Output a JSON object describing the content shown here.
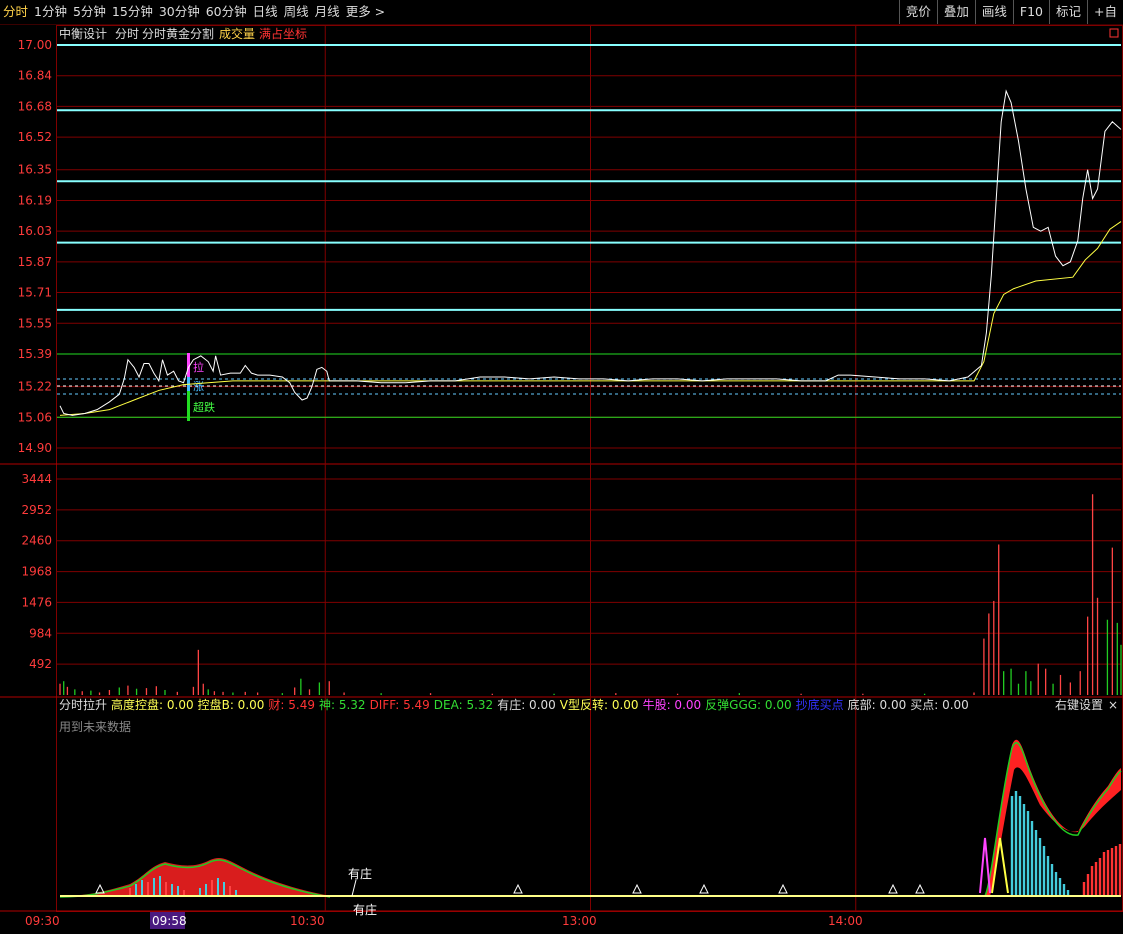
{
  "toolbar": {
    "periods": [
      "分时",
      "1分钟",
      "5分钟",
      "15分钟",
      "30分钟",
      "60分钟",
      "日线",
      "周线",
      "月线",
      "更多 >"
    ],
    "right": [
      "竞价",
      "叠加",
      "画线",
      "F10",
      "标记",
      "+自"
    ]
  },
  "price_panel": {
    "name": "中衡设计",
    "label_fenshi": "分时",
    "label_golden": "分时黄金分割",
    "label_volume": "成交量",
    "label_fullcoord": "满占坐标"
  },
  "indicator_panel": {
    "legend": [
      {
        "text": "分时拉升",
        "color": "#dddddd"
      },
      {
        "text": "高度控盘: 0.00",
        "color": "#ffff55"
      },
      {
        "text": "控盘B: 0.00",
        "color": "#ffff55"
      },
      {
        "text": "财: 5.49",
        "color": "#ff3333"
      },
      {
        "text": "神: 5.32",
        "color": "#33dd33"
      },
      {
        "text": "DIFF: 5.49",
        "color": "#ff3333"
      },
      {
        "text": "DEA: 5.32",
        "color": "#33dd33"
      },
      {
        "text": "有庄: 0.00",
        "color": "#dddddd"
      },
      {
        "text": "V型反转: 0.00",
        "color": "#ffff55"
      },
      {
        "text": "牛股: 0.00",
        "color": "#ff44ff"
      },
      {
        "text": "反弹GGG: 0.00",
        "color": "#33dd33"
      },
      {
        "text": "抄底买点",
        "color": "#3333ff"
      },
      {
        "text": "底部: 0.00",
        "color": "#dddddd"
      },
      {
        "text": "买点: 0.00",
        "color": "#dddddd"
      }
    ],
    "settings": "右键设置",
    "close": "×",
    "warning": "用到未来数据",
    "annotation": "有庄"
  },
  "signals": {
    "up": "拉",
    "mid": "涨",
    "down": "超跌"
  },
  "time_axis": {
    "labels": [
      "09:30",
      "10:30",
      "13:00",
      "14:00"
    ],
    "cursor": "09:58"
  },
  "colors": {
    "price_line": "#ffffff",
    "avg_line": "#ffff44",
    "golden": "#88ffff",
    "grid": "#800000",
    "axis_text": "#ff3b3b",
    "vol_up": "#ff4444",
    "vol_down": "#22cc22"
  },
  "chart_data": [
    {
      "type": "line",
      "y_ticks": [
        "17.00",
        "16.84",
        "16.68",
        "16.52",
        "16.35",
        "16.19",
        "16.03",
        "15.87",
        "15.71",
        "15.55",
        "15.39",
        "15.22",
        "15.06",
        "14.90"
      ],
      "ylim": [
        14.9,
        17.0
      ],
      "golden_levels": [
        17.0,
        16.66,
        16.29,
        15.97,
        15.62
      ],
      "range_levels": [
        15.39,
        15.06
      ],
      "series": [
        {
          "values": [
            [
              0,
              15.12
            ],
            [
              3,
              15.08
            ],
            [
              10,
              15.07
            ],
            [
              20,
              15.08
            ],
            [
              30,
              15.1
            ],
            [
              40,
              15.14
            ],
            [
              48,
              15.18
            ],
            [
              52,
              15.26
            ],
            [
              55,
              15.36
            ],
            [
              60,
              15.32
            ],
            [
              64,
              15.27
            ],
            [
              68,
              15.34
            ],
            [
              72,
              15.34
            ],
            [
              76,
              15.29
            ],
            [
              80,
              15.25
            ],
            [
              83,
              15.36
            ],
            [
              87,
              15.28
            ],
            [
              92,
              15.3
            ],
            [
              96,
              15.25
            ],
            [
              100,
              15.24
            ],
            [
              104,
              15.32
            ],
            [
              108,
              15.36
            ],
            [
              114,
              15.38
            ],
            [
              120,
              15.35
            ],
            [
              124,
              15.3
            ],
            [
              126,
              15.38
            ],
            [
              130,
              15.28
            ],
            [
              138,
              15.29
            ],
            [
              146,
              15.29
            ],
            [
              150,
              15.33
            ],
            [
              155,
              15.29
            ],
            [
              160,
              15.28
            ],
            [
              170,
              15.28
            ],
            [
              180,
              15.27
            ],
            [
              186,
              15.24
            ],
            [
              190,
              15.19
            ],
            [
              196,
              15.15
            ],
            [
              200,
              15.16
            ],
            [
              204,
              15.22
            ],
            [
              208,
              15.31
            ],
            [
              212,
              15.32
            ],
            [
              216,
              15.3
            ],
            [
              218,
              15.25
            ],
            [
              226,
              15.25
            ],
            [
              240,
              15.25
            ],
            [
              260,
              15.24
            ],
            [
              280,
              15.24
            ],
            [
              300,
              15.25
            ],
            [
              320,
              15.25
            ],
            [
              340,
              15.27
            ],
            [
              360,
              15.27
            ],
            [
              380,
              15.26
            ],
            [
              400,
              15.27
            ],
            [
              420,
              15.26
            ],
            [
              440,
              15.26
            ],
            [
              460,
              15.25
            ],
            [
              480,
              15.26
            ],
            [
              500,
              15.26
            ],
            [
              520,
              15.25
            ],
            [
              540,
              15.26
            ],
            [
              560,
              15.26
            ],
            [
              580,
              15.26
            ],
            [
              600,
              15.25
            ],
            [
              620,
              15.25
            ],
            [
              630,
              15.28
            ],
            [
              640,
              15.28
            ],
            [
              660,
              15.27
            ],
            [
              680,
              15.26
            ],
            [
              700,
              15.26
            ],
            [
              720,
              15.25
            ],
            [
              735,
              15.27
            ],
            [
              746,
              15.33
            ],
            [
              750,
              15.5
            ],
            [
              754,
              15.8
            ],
            [
              758,
              16.2
            ],
            [
              762,
              16.6
            ],
            [
              766,
              16.76
            ],
            [
              770,
              16.7
            ],
            [
              776,
              16.5
            ],
            [
              782,
              16.25
            ],
            [
              788,
              16.05
            ],
            [
              794,
              16.03
            ],
            [
              800,
              16.05
            ],
            [
              806,
              15.9
            ],
            [
              812,
              15.85
            ],
            [
              818,
              15.87
            ],
            [
              824,
              15.98
            ],
            [
              828,
              16.2
            ],
            [
              832,
              16.35
            ],
            [
              836,
              16.2
            ],
            [
              840,
              16.25
            ],
            [
              846,
              16.55
            ],
            [
              852,
              16.6
            ],
            [
              859,
              16.56
            ]
          ]
        },
        {
          "values": [
            [
              0,
              15.07
            ],
            [
              20,
              15.08
            ],
            [
              40,
              15.1
            ],
            [
              60,
              15.15
            ],
            [
              80,
              15.2
            ],
            [
              100,
              15.23
            ],
            [
              120,
              15.24
            ],
            [
              140,
              15.25
            ],
            [
              160,
              15.25
            ],
            [
              200,
              15.25
            ],
            [
              240,
              15.25
            ],
            [
              300,
              15.25
            ],
            [
              400,
              15.25
            ],
            [
              500,
              15.25
            ],
            [
              600,
              15.25
            ],
            [
              700,
              15.25
            ],
            [
              740,
              15.25
            ],
            [
              748,
              15.35
            ],
            [
              756,
              15.6
            ],
            [
              764,
              15.7
            ],
            [
              772,
              15.73
            ],
            [
              790,
              15.77
            ],
            [
              820,
              15.79
            ],
            [
              830,
              15.88
            ],
            [
              840,
              15.94
            ],
            [
              850,
              16.04
            ],
            [
              859,
              16.08
            ]
          ]
        }
      ]
    },
    {
      "type": "bar",
      "y_ticks": [
        "3444",
        "2952",
        "2460",
        "1968",
        "1476",
        "984",
        "492"
      ],
      "ylim": [
        0,
        3444
      ],
      "values": [
        [
          0,
          180,
          "u"
        ],
        [
          3,
          220,
          "d"
        ],
        [
          6,
          130,
          "u"
        ],
        [
          12,
          90,
          "d"
        ],
        [
          18,
          60,
          "u"
        ],
        [
          25,
          70,
          "d"
        ],
        [
          32,
          40,
          "u"
        ],
        [
          40,
          80,
          "u"
        ],
        [
          48,
          120,
          "d"
        ],
        [
          55,
          150,
          "u"
        ],
        [
          62,
          100,
          "d"
        ],
        [
          70,
          110,
          "u"
        ],
        [
          78,
          140,
          "u"
        ],
        [
          85,
          80,
          "d"
        ],
        [
          95,
          50,
          "u"
        ],
        [
          108,
          130,
          "u"
        ],
        [
          112,
          720,
          "u"
        ],
        [
          116,
          180,
          "u"
        ],
        [
          120,
          90,
          "d"
        ],
        [
          125,
          60,
          "u"
        ],
        [
          132,
          50,
          "u"
        ],
        [
          140,
          40,
          "d"
        ],
        [
          150,
          50,
          "u"
        ],
        [
          160,
          40,
          "u"
        ],
        [
          180,
          30,
          "d"
        ],
        [
          190,
          120,
          "u"
        ],
        [
          195,
          260,
          "d"
        ],
        [
          202,
          90,
          "u"
        ],
        [
          210,
          200,
          "d"
        ],
        [
          218,
          220,
          "u"
        ],
        [
          230,
          40,
          "u"
        ],
        [
          260,
          30,
          "d"
        ],
        [
          300,
          30,
          "u"
        ],
        [
          350,
          20,
          "u"
        ],
        [
          400,
          20,
          "d"
        ],
        [
          450,
          30,
          "u"
        ],
        [
          500,
          20,
          "u"
        ],
        [
          550,
          30,
          "d"
        ],
        [
          600,
          20,
          "u"
        ],
        [
          650,
          20,
          "u"
        ],
        [
          700,
          20,
          "d"
        ],
        [
          740,
          40,
          "u"
        ],
        [
          748,
          900,
          "u"
        ],
        [
          752,
          1300,
          "u"
        ],
        [
          756,
          1500,
          "u"
        ],
        [
          760,
          2400,
          "u"
        ],
        [
          764,
          380,
          "d"
        ],
        [
          770,
          420,
          "d"
        ],
        [
          776,
          180,
          "d"
        ],
        [
          782,
          380,
          "d"
        ],
        [
          786,
          220,
          "d"
        ],
        [
          792,
          500,
          "u"
        ],
        [
          798,
          420,
          "u"
        ],
        [
          804,
          180,
          "d"
        ],
        [
          810,
          320,
          "u"
        ],
        [
          818,
          200,
          "u"
        ],
        [
          826,
          380,
          "u"
        ],
        [
          832,
          1250,
          "u"
        ],
        [
          836,
          3200,
          "u"
        ],
        [
          840,
          1550,
          "u"
        ],
        [
          848,
          1200,
          "d"
        ],
        [
          852,
          2350,
          "u"
        ],
        [
          856,
          1150,
          "d"
        ],
        [
          859,
          800,
          "d"
        ]
      ]
    }
  ]
}
